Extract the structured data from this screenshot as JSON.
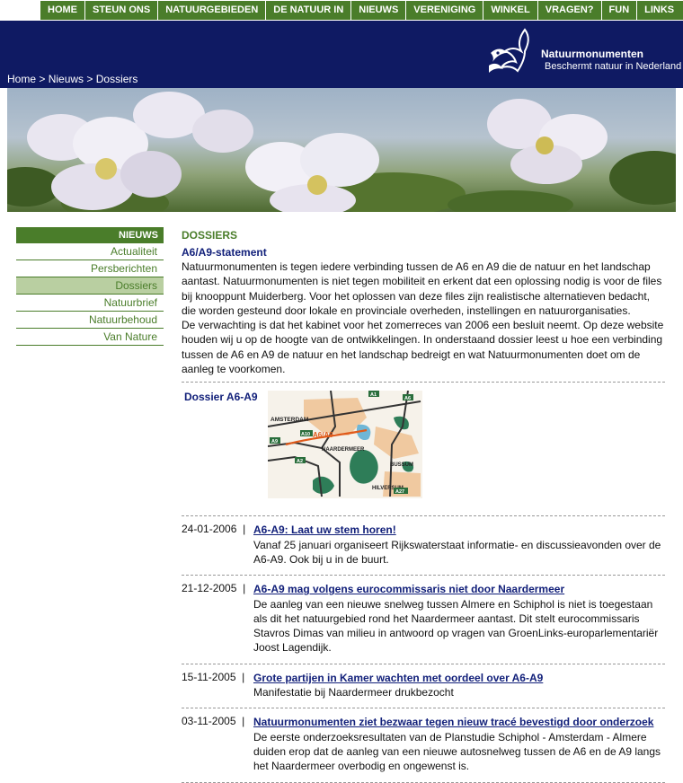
{
  "nav": [
    "HOME",
    "STEUN ONS",
    "NATUURGEBIEDEN",
    "DE NATUUR IN",
    "NIEUWS",
    "VERENIGING",
    "WINKEL",
    "VRAGEN?",
    "FUN",
    "LINKS"
  ],
  "breadcrumb": {
    "home": "Home",
    "sep": " > ",
    "news": "Nieuws",
    "current": "Dossiers"
  },
  "logo": {
    "title": "Natuurmonumenten",
    "subtitle": "Beschermt natuur in Nederland"
  },
  "sidebar": {
    "heading": "NIEUWS",
    "items": [
      "Actualiteit",
      "Persberichten",
      "Dossiers",
      "Natuurbrief",
      "Natuurbehoud",
      "Van Nature"
    ],
    "active": "Dossiers"
  },
  "main": {
    "section": "DOSSIERS",
    "article_title": "A6/A9-statement",
    "para1": "Natuurmonumenten is tegen iedere verbinding tussen de A6 en A9 die de natuur en het landschap aantast. Natuurmonumenten is niet tegen mobiliteit en erkent dat een oplossing nodig is voor de files bij knooppunt Muiderberg. Voor het oplossen van deze files zijn realistische alternatieven bedacht, die worden gesteund door lokale en provinciale overheden, instellingen en natuurorganisaties.",
    "para2": "De verwachting is dat het kabinet voor het zomerreces van 2006 een besluit neemt. Op deze website houden wij u op de hoogte van de ontwikkelingen. In onderstaand dossier leest u hoe een verbinding tussen de A6 en A9 de natuur en het landschap bedreigt en wat Natuurmonumenten doet om de aanleg te voorkomen.",
    "dossier_label": "Dossier A6-A9",
    "map_labels": {
      "amsterdam": "AMSTERDAM",
      "route": "A6/A9",
      "naardermeer": "NAARDERMEER",
      "bussum": "BUSSUM",
      "hilversum": "HILVERSUM",
      "a1": "A1",
      "a6": "A6",
      "a9": "A9",
      "a10": "A10",
      "a2": "A2",
      "a27": "A27"
    }
  },
  "news": [
    {
      "date": "24-01-2006",
      "title": "A6-A9: Laat uw stem horen!",
      "text": "Vanaf 25 januari organiseert Rijkswaterstaat informatie- en discussieavonden over de A6-A9. Ook bij u in de buurt."
    },
    {
      "date": "21-12-2005",
      "title": "A6-A9 mag volgens eurocommissaris niet door Naardermeer",
      "text": "De aanleg van een nieuwe snelweg tussen Almere en Schiphol is niet is toegestaan als dit het natuurgebied rond het Naardermeer aantast. Dit stelt eurocommissaris Stavros Dimas van milieu in antwoord op vragen van GroenLinks-europarlementariër Joost Lagendijk."
    },
    {
      "date": "15-11-2005",
      "title": "Grote partijen in Kamer wachten met oordeel over A6-A9",
      "text": "Manifestatie bij Naardermeer drukbezocht"
    },
    {
      "date": "03-11-2005",
      "title": "Natuurmonumenten ziet bezwaar tegen nieuw tracé bevestigd door onderzoek",
      "text": "De eerste onderzoeksresultaten van de Planstudie Schiphol - Amsterdam - Almere duiden erop dat de aanleg van een nieuwe autosnelweg tussen de A6 en de A9 langs het Naardermeer overbodig en ongewenst is."
    }
  ],
  "news_sep": "|",
  "colors": {
    "green": "#4a7d2a",
    "navy": "#0f1a63",
    "link": "#12207a",
    "active_bg": "#b9cfa1"
  }
}
